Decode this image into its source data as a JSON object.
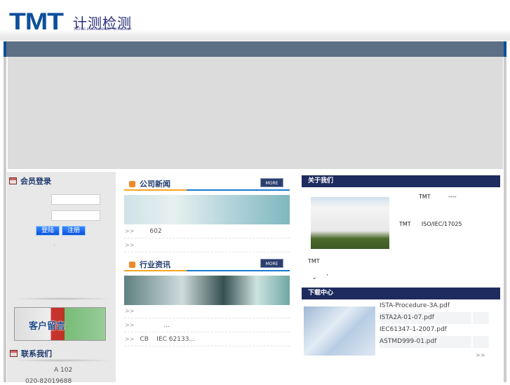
{
  "header": {
    "logo_brand": "TMT",
    "logo_cn": "计测检测",
    "logo_en": "TESTING & MEASUREMENT TECHNOLOGY"
  },
  "sidebar": {
    "login_title": "会员登录",
    "login_button": "登陆",
    "register_button": "注册",
    "dot": ".",
    "message_banner": "客户留言",
    "contact_title": "联系我们",
    "address": "A 102",
    "phone": "020-82019688"
  },
  "company_news": {
    "title": "公司新闻",
    "more": "MORE",
    "items": [
      {
        "arrow": ">>",
        "text": "602"
      },
      {
        "arrow": ">>",
        "text": ""
      }
    ]
  },
  "industry_news": {
    "title": "行业资讯",
    "more": "MORE",
    "items": [
      {
        "arrow": ">>",
        "text": ""
      },
      {
        "arrow": ">>",
        "text": "..."
      },
      {
        "arrow": ">>",
        "text": "CB    IEC 62133..."
      }
    ]
  },
  "about": {
    "title": "关于我们",
    "line1": "TMT          ----",
    "line2": "TMT      ISO/IEC/17025",
    "line3": "TMT",
    "line4": "„      ’"
  },
  "downloads": {
    "title": "下载中心",
    "files": [
      "ISTA-Procedure-3A.pdf",
      "ISTA2A-01-07.pdf",
      "IEC61347-1-2007.pdf",
      "ASTMD999-01.pdf"
    ],
    "more": ">>"
  }
}
